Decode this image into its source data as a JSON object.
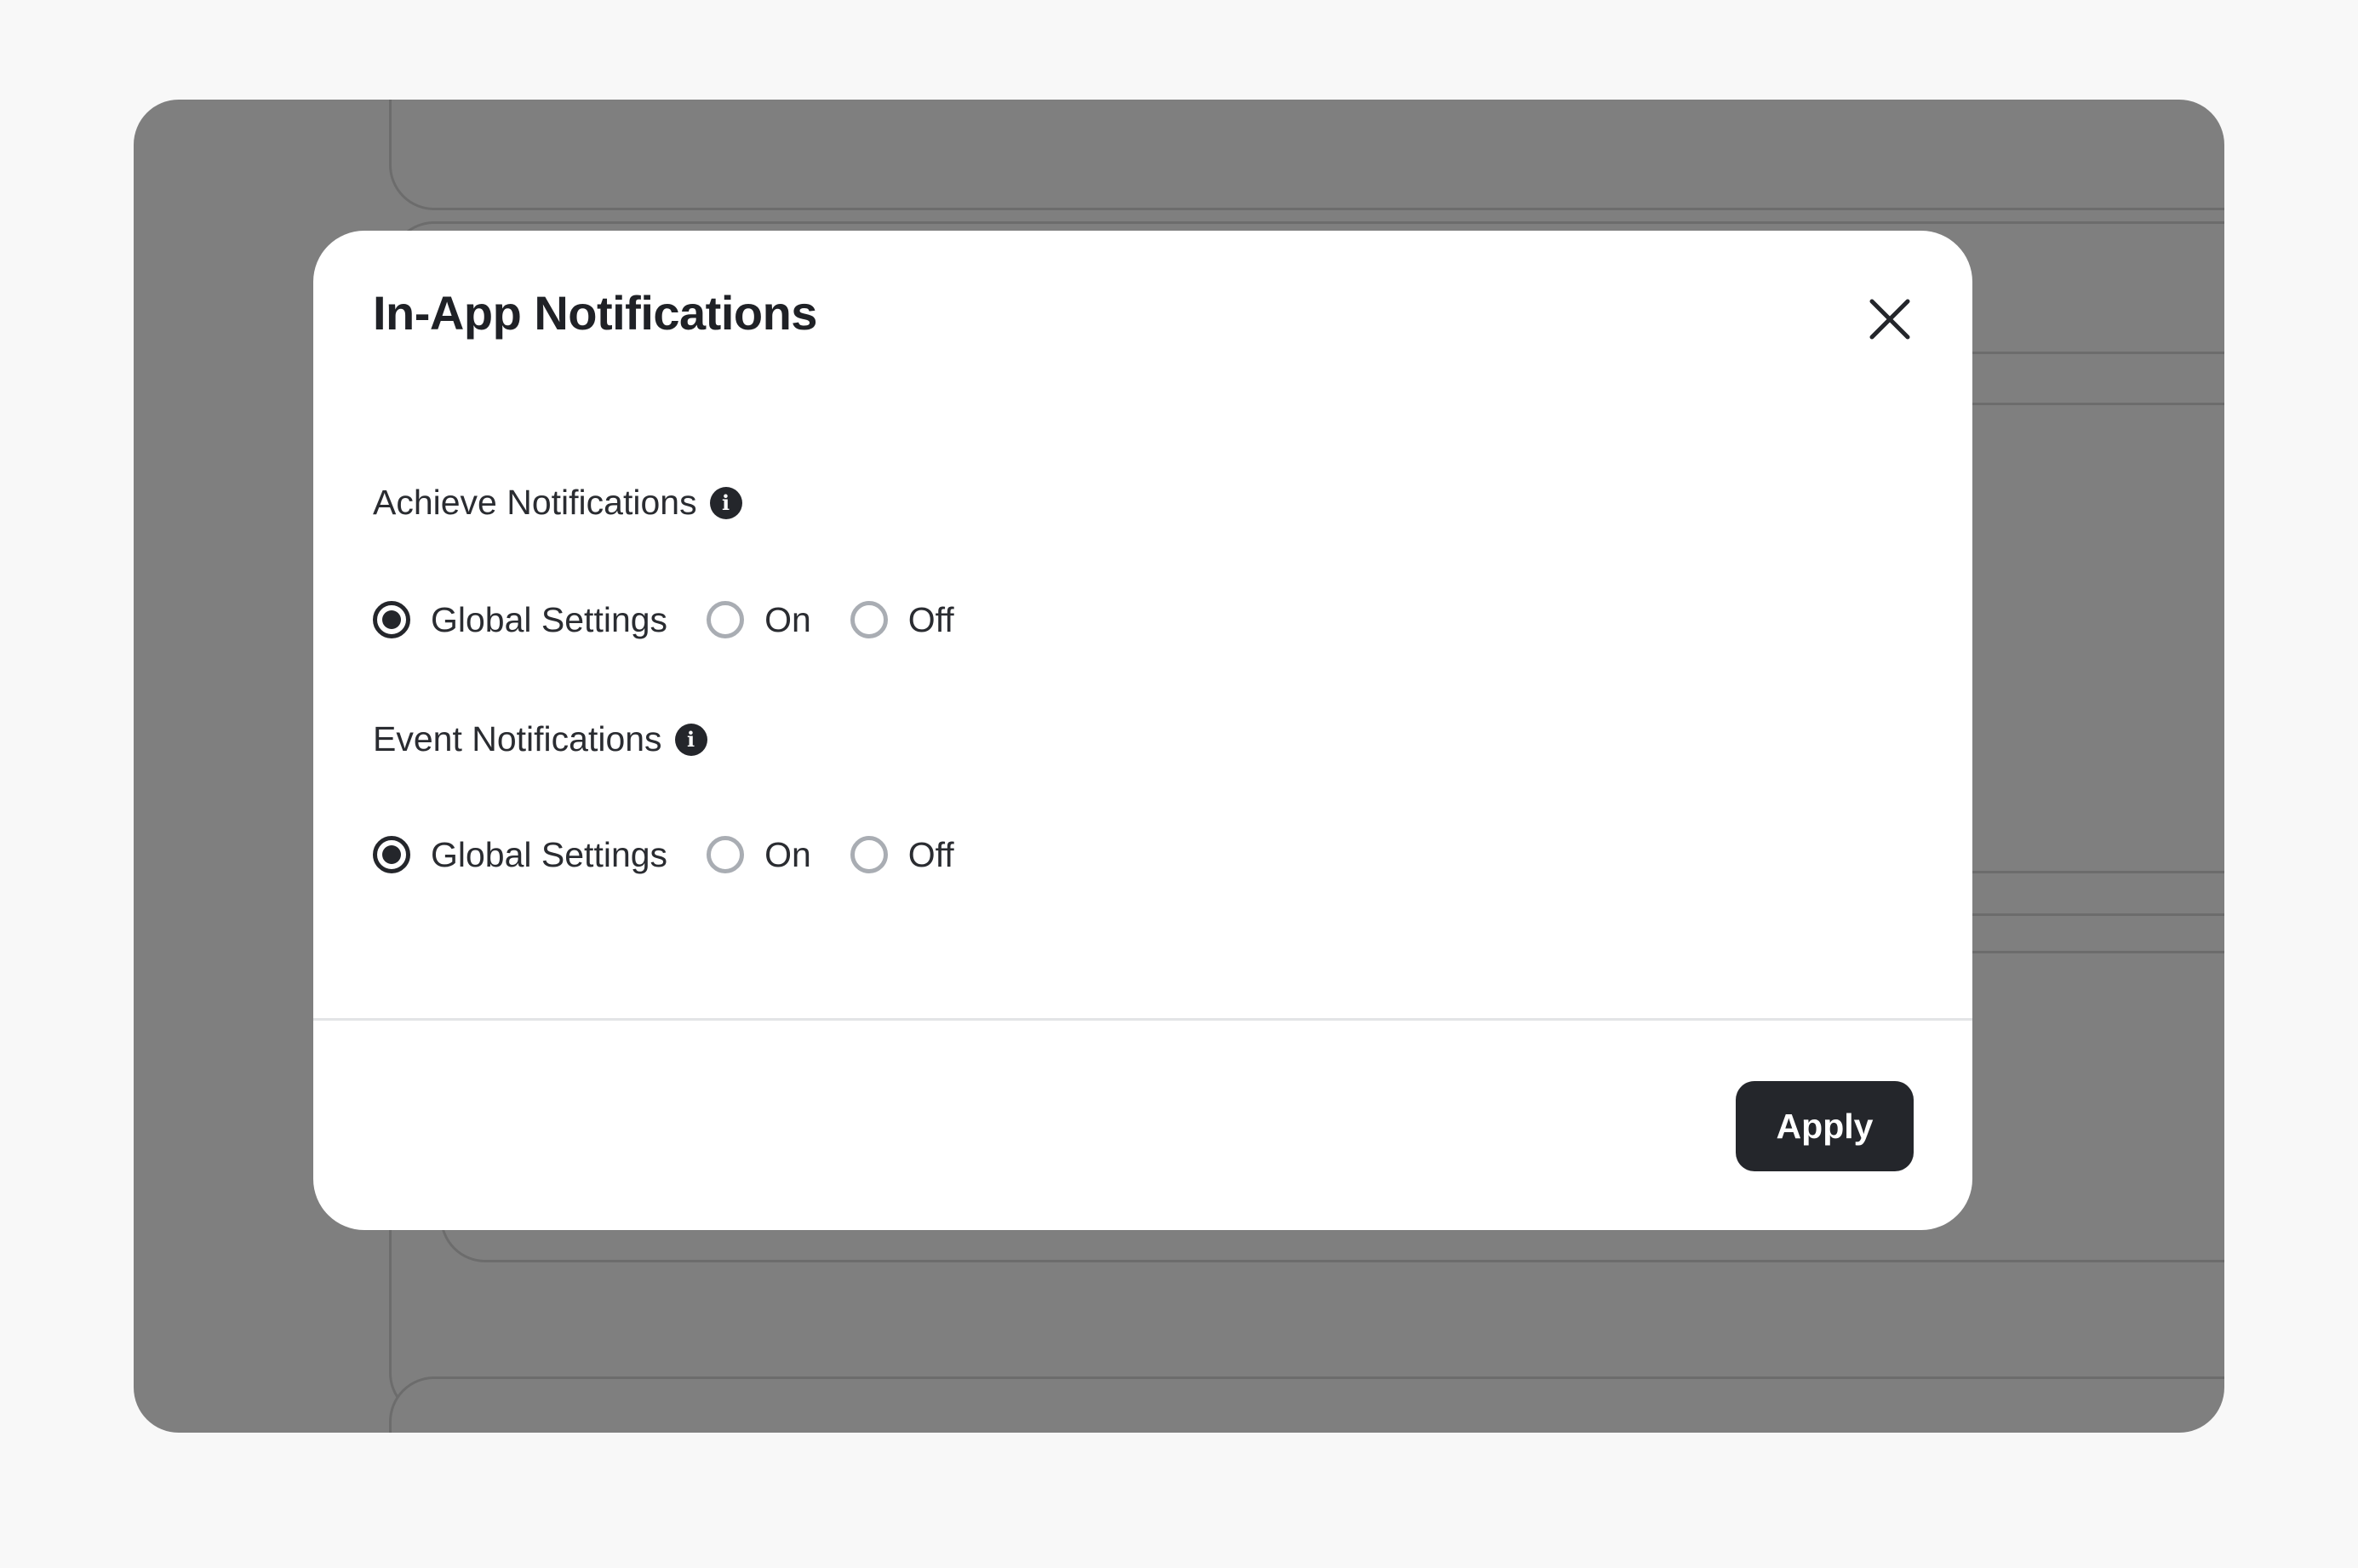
{
  "modal": {
    "title": "In-App Notifications",
    "close_icon": "close-icon",
    "apply_label": "Apply"
  },
  "sections": [
    {
      "label": "Achieve Notifications",
      "info_icon": "info-icon",
      "options": [
        {
          "label": "Global Settings",
          "selected": true
        },
        {
          "label": "On",
          "selected": false
        },
        {
          "label": "Off",
          "selected": false
        }
      ]
    },
    {
      "label": "Event Notifications",
      "info_icon": "info-icon",
      "options": [
        {
          "label": "Global Settings",
          "selected": true
        },
        {
          "label": "On",
          "selected": false
        },
        {
          "label": "Off",
          "selected": false
        }
      ]
    }
  ],
  "colors": {
    "primary": "#24262b",
    "overlay": "rgba(0,0,0,0.5)",
    "radio_unchecked": "#a9adb3",
    "page_background": "#f8f8f8"
  }
}
